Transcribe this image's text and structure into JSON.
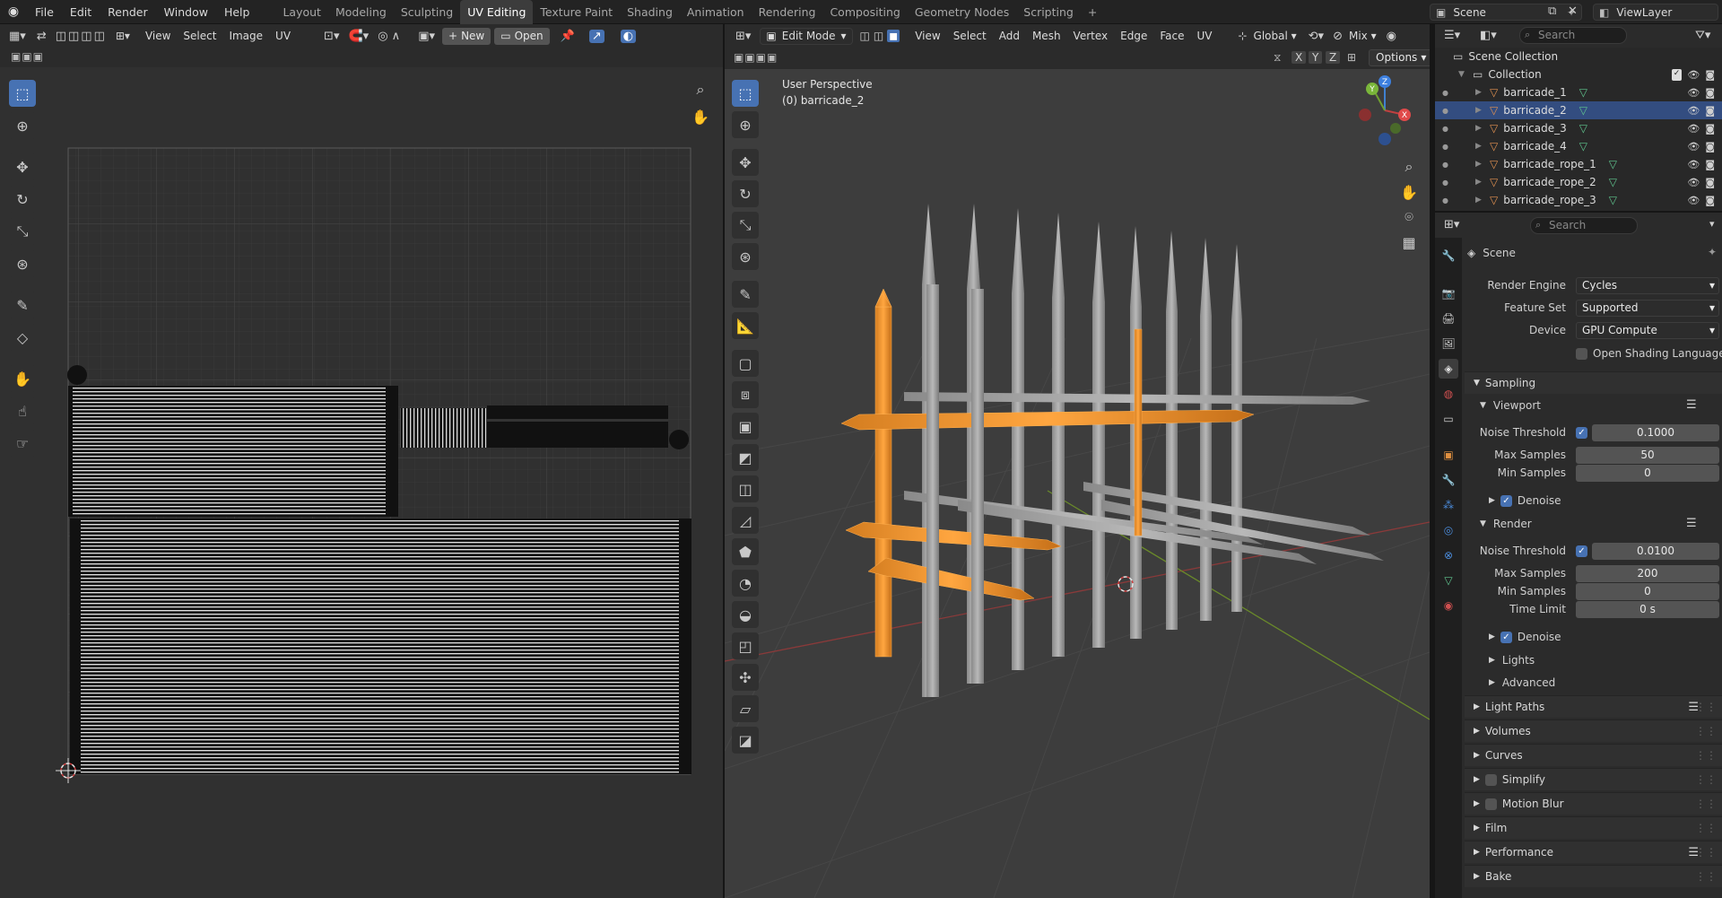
{
  "topbar": {
    "menus": [
      "File",
      "Edit",
      "Render",
      "Window",
      "Help"
    ],
    "workspaces": [
      "Layout",
      "Modeling",
      "Sculpting",
      "UV Editing",
      "Texture Paint",
      "Shading",
      "Animation",
      "Rendering",
      "Compositing",
      "Geometry Nodes",
      "Scripting"
    ],
    "active_workspace": "UV Editing",
    "add": "+",
    "scene": "Scene",
    "view_layer": "ViewLayer"
  },
  "uv_editor": {
    "menus": [
      "View",
      "Select",
      "Image",
      "UV"
    ],
    "new_label": "New",
    "open_label": "Open"
  },
  "viewport": {
    "mode": "Edit Mode",
    "menus": [
      "View",
      "Select",
      "Add",
      "Mesh",
      "Vertex",
      "Edge",
      "Face",
      "UV"
    ],
    "orientation": "Global",
    "pivot": "Mix",
    "options": "Options",
    "axes": [
      "X",
      "Y",
      "Z"
    ],
    "overlay_line1": "User Perspective",
    "overlay_line2": "(0) barricade_2",
    "gizmo": {
      "x": "X",
      "y": "Y",
      "z": "Z"
    }
  },
  "outliner": {
    "search_placeholder": "Search",
    "root": "Scene Collection",
    "collection": "Collection",
    "items": [
      {
        "name": "barricade_1",
        "selected": false
      },
      {
        "name": "barricade_2",
        "selected": true
      },
      {
        "name": "barricade_3",
        "selected": false
      },
      {
        "name": "barricade_4",
        "selected": false
      },
      {
        "name": "barricade_rope_1",
        "selected": false
      },
      {
        "name": "barricade_rope_2",
        "selected": false
      },
      {
        "name": "barricade_rope_3",
        "selected": false
      }
    ]
  },
  "properties": {
    "search_placeholder": "Search",
    "context": "Scene",
    "render_engine_label": "Render Engine",
    "render_engine": "Cycles",
    "feature_set_label": "Feature Set",
    "feature_set": "Supported",
    "device_label": "Device",
    "device": "GPU Compute",
    "osl_label": "Open Shading Language",
    "sampling": "Sampling",
    "viewport": "Viewport",
    "render": "Render",
    "noise_threshold_label": "Noise Threshold",
    "max_samples_label": "Max Samples",
    "min_samples_label": "Min Samples",
    "time_limit_label": "Time Limit",
    "denoise_label": "Denoise",
    "vp_noise": "0.1000",
    "vp_max": "50",
    "vp_min": "0",
    "r_noise": "0.0100",
    "r_max": "200",
    "r_min": "0",
    "r_time": "0 s",
    "lights": "Lights",
    "advanced": "Advanced",
    "sections": [
      "Light Paths",
      "Volumes",
      "Curves",
      "Simplify",
      "Motion Blur",
      "Film",
      "Performance",
      "Bake"
    ]
  }
}
